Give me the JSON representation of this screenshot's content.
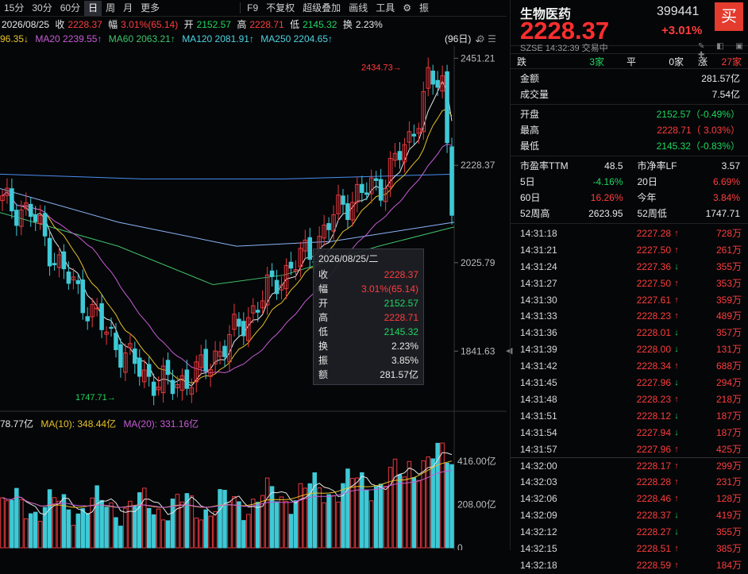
{
  "toolbar": {
    "items": [
      "15分",
      "30分",
      "60分",
      "日",
      "周",
      "月",
      "更多",
      "F9",
      "不复权",
      "超级叠加",
      "画线",
      "工具"
    ],
    "active": "日",
    "right_label": "振"
  },
  "info1": {
    "date": "2026/08/25",
    "close_label": "收",
    "close": "2228.37",
    "range_label": "幅",
    "range": "3.01%(65.14)",
    "open_label": "开",
    "open": "2152.57",
    "high_label": "高",
    "high": "2228.71",
    "low_label": "低",
    "low": "2145.32",
    "turn_label": "换",
    "turn": "2.23%"
  },
  "info2": {
    "ma10": "96.35↓",
    "ma20": "MA20 2239.55↑",
    "ma60": "MA60 2063.21↑",
    "ma120": "MA120 2081.91↑",
    "ma250": "MA250 2204.65↑",
    "days": "(96日)"
  },
  "price_axis": [
    "2451.21",
    "2228.37",
    "2025.79",
    "1841.63"
  ],
  "annot": {
    "high": "2434.73",
    "low": "1747.71"
  },
  "vol_head": {
    "vol": "78.77亿",
    "ma10": "MA(10): 348.44亿",
    "ma20": "MA(20): 331.16亿"
  },
  "vol_axis": [
    "416.00亿",
    "208.00亿",
    "0"
  ],
  "tooltip": {
    "date": "2026/08/25/二",
    "rows": [
      {
        "k": "收",
        "v": "2228.37",
        "c": "red"
      },
      {
        "k": "幅",
        "v": "3.01%(65.14)",
        "c": "red"
      },
      {
        "k": "开",
        "v": "2152.57",
        "c": "green"
      },
      {
        "k": "高",
        "v": "2228.71",
        "c": "red"
      },
      {
        "k": "低",
        "v": "2145.32",
        "c": "green"
      },
      {
        "k": "换",
        "v": "2.23%",
        "c": "white"
      },
      {
        "k": "振",
        "v": "3.85%",
        "c": "white"
      },
      {
        "k": "额",
        "v": "281.57亿",
        "c": "white"
      }
    ]
  },
  "panel": {
    "name": "生物医药",
    "code": "399441",
    "buy": "买",
    "price": "2228.37",
    "pct": "+3.01%",
    "sub": "SZSE  14:32:39  交易中",
    "adv": {
      "down_label": "跌",
      "down": "3家",
      "flat_label": "平",
      "flat": "0家",
      "up_label": "涨",
      "up": "27家"
    },
    "stats": [
      {
        "k": "金额",
        "v": "281.57亿",
        "c": "white"
      },
      {
        "k": "成交量",
        "v": "7.54亿",
        "c": "white"
      }
    ],
    "prices": [
      {
        "k": "开盘",
        "v": "2152.57（-0.49%）",
        "c": "green"
      },
      {
        "k": "最高",
        "v": "2228.71（ 3.03%）",
        "c": "red"
      },
      {
        "k": "最低",
        "v": "2145.32（-0.83%）",
        "c": "green"
      }
    ],
    "grid": [
      {
        "k": "市盈率TTM",
        "v": "48.5",
        "c": "white"
      },
      {
        "k": "市净率LF",
        "v": "3.57",
        "c": "white"
      },
      {
        "k": "5日",
        "v": "-4.16%",
        "c": "green"
      },
      {
        "k": "20日",
        "v": "6.69%",
        "c": "red"
      },
      {
        "k": "60日",
        "v": "16.26%",
        "c": "red"
      },
      {
        "k": "今年",
        "v": "3.84%",
        "c": "red"
      },
      {
        "k": "52周高",
        "v": "2623.95",
        "c": "white"
      },
      {
        "k": "52周低",
        "v": "1747.71",
        "c": "white"
      }
    ],
    "ticks": [
      {
        "t": "14:31:18",
        "p": "2227.28",
        "d": "up",
        "v": "728万"
      },
      {
        "t": "14:31:21",
        "p": "2227.50",
        "d": "up",
        "v": "261万"
      },
      {
        "t": "14:31:24",
        "p": "2227.36",
        "d": "down",
        "v": "355万"
      },
      {
        "t": "14:31:27",
        "p": "2227.50",
        "d": "up",
        "v": "353万"
      },
      {
        "t": "14:31:30",
        "p": "2227.61",
        "d": "up",
        "v": "359万"
      },
      {
        "t": "14:31:33",
        "p": "2228.23",
        "d": "up",
        "v": "489万"
      },
      {
        "t": "14:31:36",
        "p": "2228.01",
        "d": "down",
        "v": "357万"
      },
      {
        "t": "14:31:39",
        "p": "2228.00",
        "d": "down",
        "v": "131万"
      },
      {
        "t": "14:31:42",
        "p": "2228.34",
        "d": "up",
        "v": "688万"
      },
      {
        "t": "14:31:45",
        "p": "2227.96",
        "d": "down",
        "v": "294万"
      },
      {
        "t": "14:31:48",
        "p": "2228.23",
        "d": "up",
        "v": "218万"
      },
      {
        "t": "14:31:51",
        "p": "2228.12",
        "d": "down",
        "v": "187万"
      },
      {
        "t": "14:31:54",
        "p": "2227.94",
        "d": "down",
        "v": "187万"
      },
      {
        "t": "14:31:57",
        "p": "2227.96",
        "d": "up",
        "v": "425万"
      },
      {
        "t": "14:32:00",
        "p": "2228.17",
        "d": "up",
        "v": "299万"
      },
      {
        "t": "14:32:03",
        "p": "2228.28",
        "d": "up",
        "v": "231万"
      },
      {
        "t": "14:32:06",
        "p": "2228.46",
        "d": "up",
        "v": "128万"
      },
      {
        "t": "14:32:09",
        "p": "2228.37",
        "d": "down",
        "v": "419万"
      },
      {
        "t": "14:32:12",
        "p": "2228.27",
        "d": "down",
        "v": "355万"
      },
      {
        "t": "14:32:15",
        "p": "2228.51",
        "d": "up",
        "v": "385万"
      },
      {
        "t": "14:32:18",
        "p": "2228.59",
        "d": "up",
        "v": "184万"
      }
    ]
  },
  "colors": {
    "up": "#ff3d3d",
    "down": "#1ed760",
    "candle_up": "#e8383d",
    "candle_down": "#3ec9d6",
    "ma5": "#e6e6e6",
    "ma10": "#e6c229",
    "ma20": "#c75bd6",
    "ma60": "#3fc36b",
    "ma120": "#4a8ef0",
    "ma250": "#8ab4f8"
  }
}
